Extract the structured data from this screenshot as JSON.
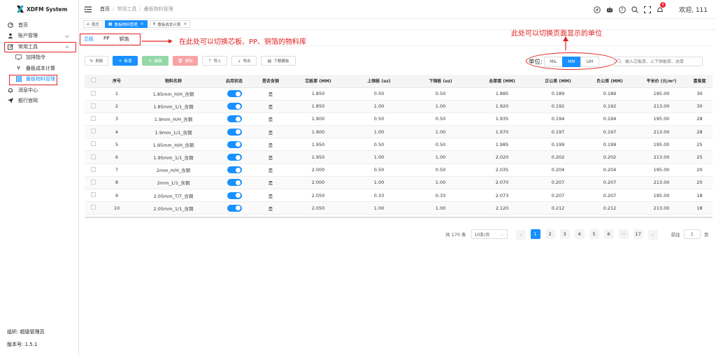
{
  "app": {
    "title": "XDFM System"
  },
  "sidebar": {
    "items": [
      {
        "label": "首页",
        "icon": "dashboard-icon"
      },
      {
        "label": "账户管理",
        "icon": "user-icon"
      },
      {
        "label": "常用工具",
        "icon": "edit-icon"
      },
      {
        "label": "加排指令",
        "icon": "command-icon"
      },
      {
        "label": "叠板成本计算",
        "icon": "yen-icon"
      },
      {
        "label": "叠板物料管理",
        "icon": "grid-icon"
      },
      {
        "label": "消息中心",
        "icon": "bell-icon"
      },
      {
        "label": "舰行官网",
        "icon": "send-icon"
      }
    ],
    "footer": {
      "org": "组织: 超级管理员",
      "version": "版本号: 1.5.1"
    }
  },
  "header": {
    "breadcrumb": [
      "首页",
      "常用工具",
      "叠板物料管理"
    ],
    "notification_count": "6",
    "welcome": "欢迎, 111"
  },
  "tabs": [
    {
      "label": "首页"
    },
    {
      "label": "叠板物料管理"
    },
    {
      "label": "叠板成本计算"
    }
  ],
  "subtabs": [
    "芯板",
    "PP",
    "铜箔"
  ],
  "annotations": {
    "subtabs_note": "在此处可以切换芯板、PP、铜箔的物料库",
    "unit_note": "此处可以切换页面显示的单位"
  },
  "toolbar": {
    "refresh": "刷新",
    "add": "新增",
    "edit": "编辑",
    "delete": "删除",
    "import": "导入",
    "export": "导出",
    "template": "下载模板"
  },
  "unit": {
    "label": "单位:",
    "options": [
      "MIL",
      "MM",
      "UM"
    ],
    "selected": "MM"
  },
  "search": {
    "placeholder": "输入芯板厚、上下铜板厚、总厚"
  },
  "table": {
    "headers": [
      "序号",
      "物料名称",
      "启用状态",
      "是否含铜",
      "芯板厚 (MM)",
      "上铜板 (oz)",
      "下铜板 (oz)",
      "总厚度 (MM)",
      "正公差 (MM)",
      "负公差 (MM)",
      "平米价 (元/m²)",
      "喜爱度"
    ],
    "rows": [
      [
        "1",
        "1.85mm_H/H_含铜",
        "是",
        "1.850",
        "0.50",
        "0.50",
        "1.885",
        "0.189",
        "0.189",
        "195.00",
        "30"
      ],
      [
        "2",
        "1.85mm_1/1_含铜",
        "是",
        "1.850",
        "1.00",
        "1.00",
        "1.920",
        "0.192",
        "0.192",
        "213.00",
        "30"
      ],
      [
        "3",
        "1.9mm_H/H_含铜",
        "是",
        "1.900",
        "0.50",
        "0.50",
        "1.935",
        "0.194",
        "0.194",
        "195.00",
        "28"
      ],
      [
        "4",
        "1.9mm_1/1_含铜",
        "是",
        "1.900",
        "1.00",
        "1.00",
        "1.970",
        "0.197",
        "0.197",
        "213.00",
        "28"
      ],
      [
        "5",
        "1.95mm_H/H_含铜",
        "是",
        "1.950",
        "0.50",
        "0.50",
        "1.985",
        "0.199",
        "0.199",
        "195.00",
        "25"
      ],
      [
        "6",
        "1.95mm_1/1_含铜",
        "是",
        "1.950",
        "1.00",
        "1.00",
        "2.020",
        "0.202",
        "0.202",
        "213.00",
        "25"
      ],
      [
        "7",
        "2mm_H/H_含铜",
        "是",
        "2.000",
        "0.50",
        "0.50",
        "2.035",
        "0.204",
        "0.204",
        "195.00",
        "20"
      ],
      [
        "8",
        "2mm_1/1_含铜",
        "是",
        "2.000",
        "1.00",
        "1.00",
        "2.070",
        "0.207",
        "0.207",
        "213.00",
        "20"
      ],
      [
        "9",
        "2.05mm_T/T_含铜",
        "是",
        "2.050",
        "0.33",
        "0.33",
        "2.073",
        "0.207",
        "0.207",
        "195.00",
        "18"
      ],
      [
        "10",
        "2.05mm_1/1_含铜",
        "是",
        "2.050",
        "1.00",
        "1.00",
        "2.120",
        "0.212",
        "0.212",
        "213.00",
        "18"
      ]
    ]
  },
  "pagination": {
    "total": "共 170 条",
    "page_size": "10条/页",
    "pages": [
      "1",
      "2",
      "3",
      "4",
      "5",
      "6",
      "···",
      "17"
    ],
    "current": "1",
    "goto_label": "前往",
    "goto_value": "1",
    "goto_suffix": "页"
  },
  "colors": {
    "accent": "#1890ff",
    "annotation": "#e02020"
  }
}
